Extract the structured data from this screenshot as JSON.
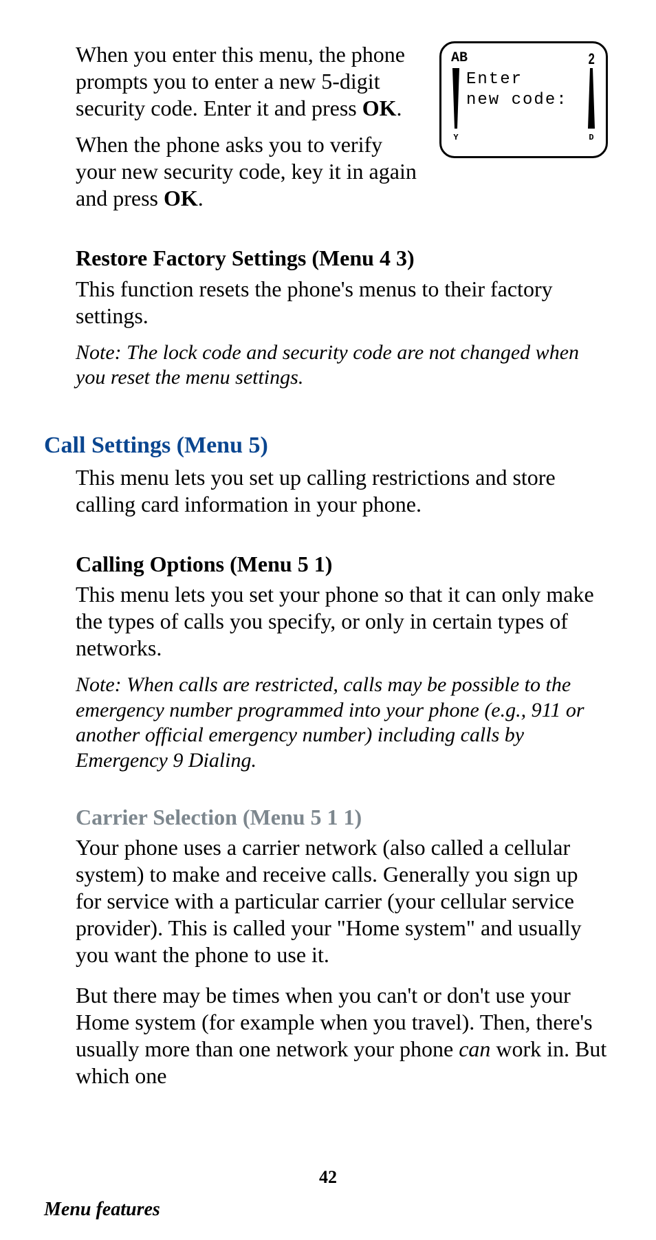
{
  "phone_screen": {
    "top_left": "AB",
    "top_right": "2",
    "line1": "Enter",
    "line2": "new code:",
    "left_letter": "Y",
    "right_letter": "D"
  },
  "p1_a": "When you enter this menu, the phone prompts you to enter a new 5-digit security code. Enter it and press ",
  "p1_b": "OK",
  "p1_c": ".",
  "p2_a": "When the phone asks you to verify your new security code, key it in again and press ",
  "p2_b": "OK",
  "p2_c": ".",
  "h_restore": "Restore Factory Settings (Menu 4 3)",
  "p3": "This function resets the phone's menus to their factory settings.",
  "note1": "Note: The lock code and security code are not changed when you reset the menu settings.",
  "h_call": "Call Settings (Menu 5)",
  "p4": "This menu lets you set up calling restrictions and store calling card information in your phone.",
  "h_calling_opts": "Calling Options (Menu 5 1)",
  "p5": "This menu lets you set your phone so that it can only make the types of calls you specify, or only in certain types of networks.",
  "note2": "Note: When calls are restricted, calls may be possible to the emergency number programmed into your phone (e.g., 911 or another official emergency number) including calls by Emergency 9 Dialing.",
  "h_carrier": "Carrier Selection (Menu 5 1 1)",
  "p6": "Your phone uses a carrier network (also called a cellular system) to make and receive calls. Generally you sign up for service with a particular carrier (your cellular service provider). This is called your \"Home system\" and usually you want the phone to use it.",
  "p7_a": "But there may be times when you can't or don't use your Home system (for example when you travel). Then, there's usually more than one network your phone ",
  "p7_b": "can",
  "p7_c": " work in. But which one",
  "page_number": "42",
  "footer": "Menu features"
}
